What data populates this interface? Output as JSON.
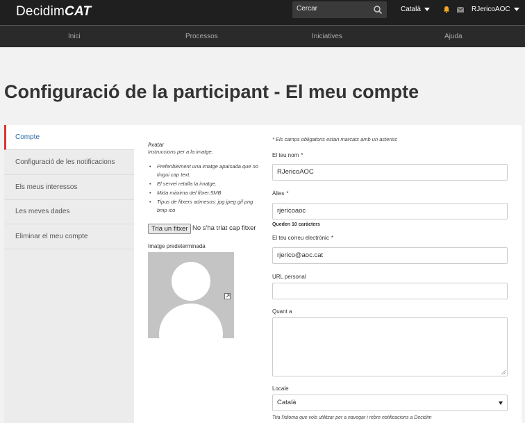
{
  "header": {
    "logo_plain": "Decidim",
    "logo_bold": "CAT",
    "search_placeholder": "Cercar",
    "language": "Català",
    "username": "RJericoAOC",
    "accent_color": "#f5a623"
  },
  "nav": {
    "items": [
      {
        "label": "Inici"
      },
      {
        "label": "Processos"
      },
      {
        "label": "Iniciatives"
      },
      {
        "label": "Ajuda"
      }
    ]
  },
  "page": {
    "title": "Configuració de la participant - El meu compte"
  },
  "sidebar": {
    "active_color": "#dd3333",
    "items": [
      {
        "label": "Compte",
        "active": true
      },
      {
        "label": "Configuració de les notificacions"
      },
      {
        "label": "Els meus interessos"
      },
      {
        "label": "Les meves dades"
      },
      {
        "label": "Eliminar el meu compte"
      }
    ]
  },
  "avatar": {
    "title": "Avatar",
    "instructions": "Instruccions per a la imatge:",
    "tips": [
      "Preferiblement una imatge apaïsada que no tingui cap text.",
      "El servei retalla la imatge.",
      "Mida màxima del fitxer:5MB",
      "Tipus de fitxers admesos: jpg jpeg gif png bmp ico"
    ],
    "file_button": "Tria un fitxer",
    "file_status": "No s'ha triat cap fitxer",
    "default_label": "Imatge predeterminada"
  },
  "form": {
    "required_note": "* Els camps obligatoris estan marcats amb un asterisc",
    "name_label": "El teu nom",
    "name_value": "RJericoAOC",
    "alias_label": "Àlies",
    "alias_value": "rjericoaoc",
    "alias_hint": "Queden 10 caràcters",
    "email_label": "El teu correu electrònic",
    "email_value": "rjerico@aoc.cat",
    "url_label": "URL personal",
    "url_value": "",
    "about_label": "Quant a",
    "locale_label": "Locale",
    "locale_value": "Català",
    "locale_help": "Tria l'idioma que vols utilitzar per a navegar i rebre notificacions a Decidim",
    "asterisk": "*"
  }
}
